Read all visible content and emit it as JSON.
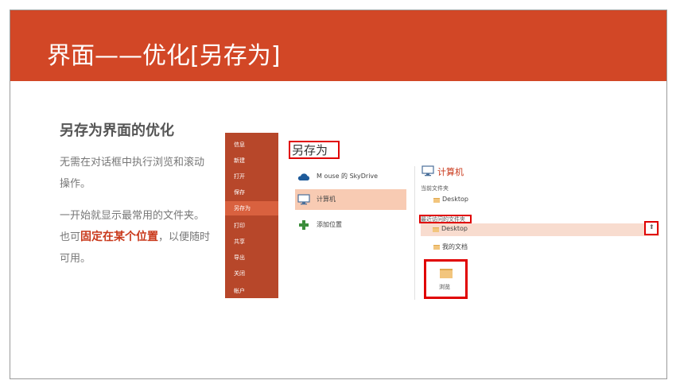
{
  "slide": {
    "title": "界面——优化[另存为]",
    "subtitle": "另存为界面的优化",
    "para1": "无需在对话框中执行浏览和滚动操作。",
    "para2_before": "一开始就显示最常用的文件夹。也可",
    "para2_highlight": "固定在某个位置",
    "para2_after": "，以便随时可用。"
  },
  "backstage": {
    "items": [
      "信息",
      "新建",
      "打开",
      "保存",
      "另存为",
      "打印",
      "共享",
      "导出",
      "关闭",
      "帐户"
    ],
    "active_item": "另存为"
  },
  "saveas": {
    "header": "另存为",
    "places": [
      {
        "label": "M ouse 的 SkyDrive",
        "icon": "skydrive-cloud-icon"
      },
      {
        "label": "计算机",
        "icon": "computer-icon"
      },
      {
        "label": "添加位置",
        "icon": "add-plus-icon"
      }
    ],
    "selected_place": "计算机"
  },
  "computer_panel": {
    "title": "计算机",
    "current_folder_label": "当前文件夹",
    "current_folder": "Desktop",
    "recent_label": "最近访问的文件夹",
    "recent_folder": "Desktop",
    "my_docs": "我的文档",
    "browse_label": "浏览",
    "pin_icon": "pin-icon"
  },
  "colors": {
    "banner": "#d24726",
    "backstage": "#b7472a",
    "backstage_active": "#d9613f",
    "highlight_text": "#c9381a",
    "annotation_box": "#e00000",
    "selected_place": "#f8cbb3"
  }
}
